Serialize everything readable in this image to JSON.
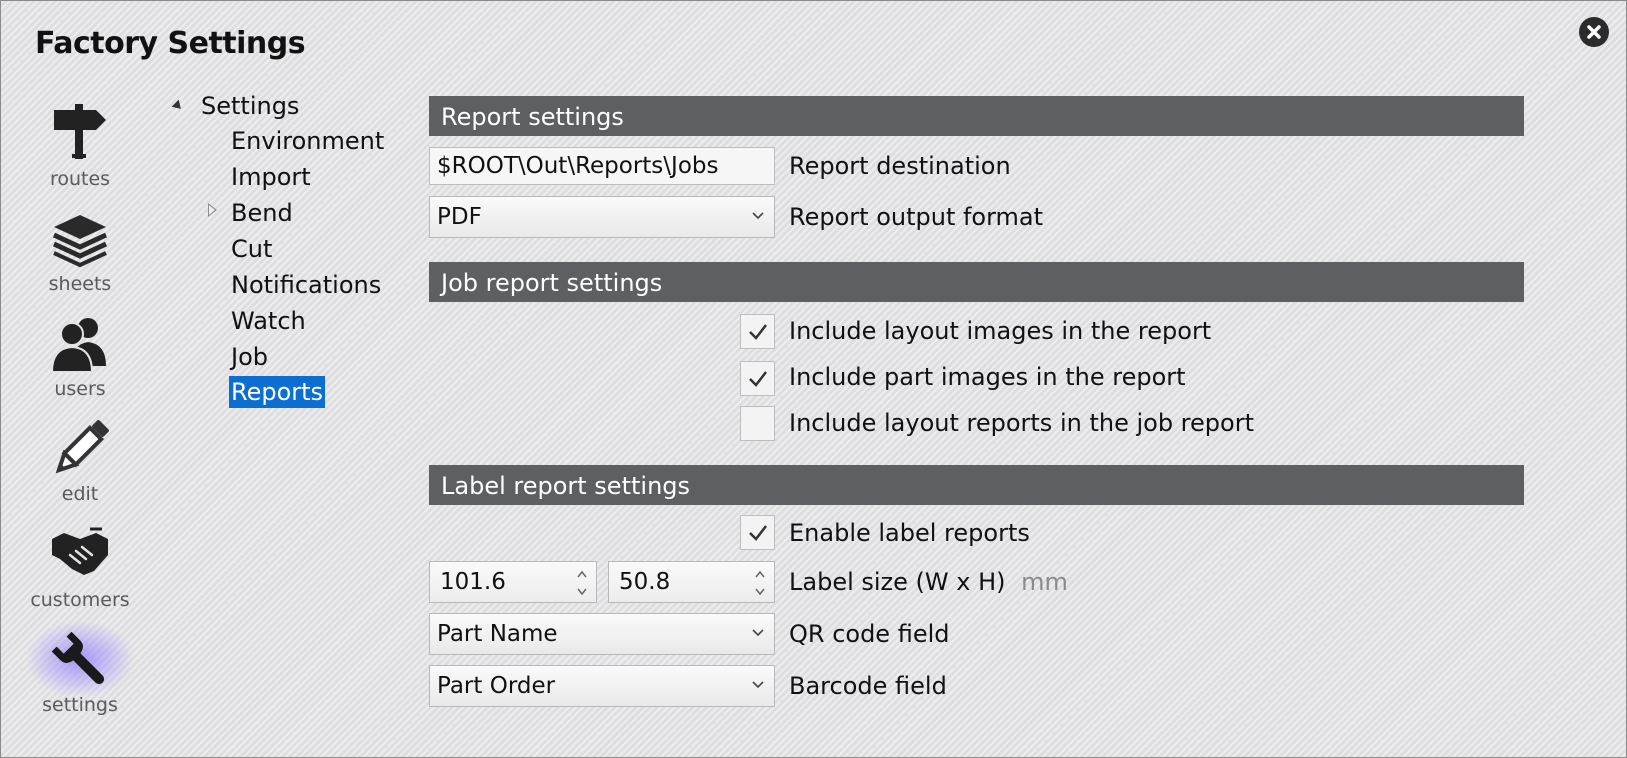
{
  "window": {
    "title": "Factory Settings"
  },
  "nav": [
    {
      "label": "routes",
      "icon": "signpost-icon"
    },
    {
      "label": "sheets",
      "icon": "sheets-stack-icon"
    },
    {
      "label": "users",
      "icon": "users-icon"
    },
    {
      "label": "edit",
      "icon": "pencil-icon"
    },
    {
      "label": "customers",
      "icon": "handshake-icon"
    },
    {
      "label": "settings",
      "icon": "wrench-icon",
      "active": true
    }
  ],
  "tree": {
    "root": "Settings",
    "items": [
      "Environment",
      "Import",
      "Bend",
      "Cut",
      "Notifications",
      "Watch",
      "Job",
      "Reports"
    ],
    "selected": "Reports"
  },
  "report_settings": {
    "header": "Report settings",
    "destination_value": "$ROOT\\Out\\Reports\\Jobs",
    "destination_label": "Report destination",
    "format_value": "PDF",
    "format_label": "Report output format"
  },
  "job_report_settings": {
    "header": "Job report settings",
    "options": [
      {
        "label": "Include layout images in the report",
        "checked": true
      },
      {
        "label": "Include part images in the report",
        "checked": true
      },
      {
        "label": "Include layout reports in the job report",
        "checked": false
      }
    ]
  },
  "label_report_settings": {
    "header": "Label report settings",
    "enable_label": "Enable label reports",
    "enable_checked": true,
    "width_value": "101.6",
    "height_value": "50.8",
    "size_label": "Label size (W x H)",
    "size_unit": "mm",
    "qr_value": "Part Name",
    "qr_label": "QR code field",
    "barcode_value": "Part Order",
    "barcode_label": "Barcode field"
  },
  "colors": {
    "header_bg": "#5e5f63",
    "selection": "#0a6fd1",
    "active_glow": "#9682ff"
  }
}
